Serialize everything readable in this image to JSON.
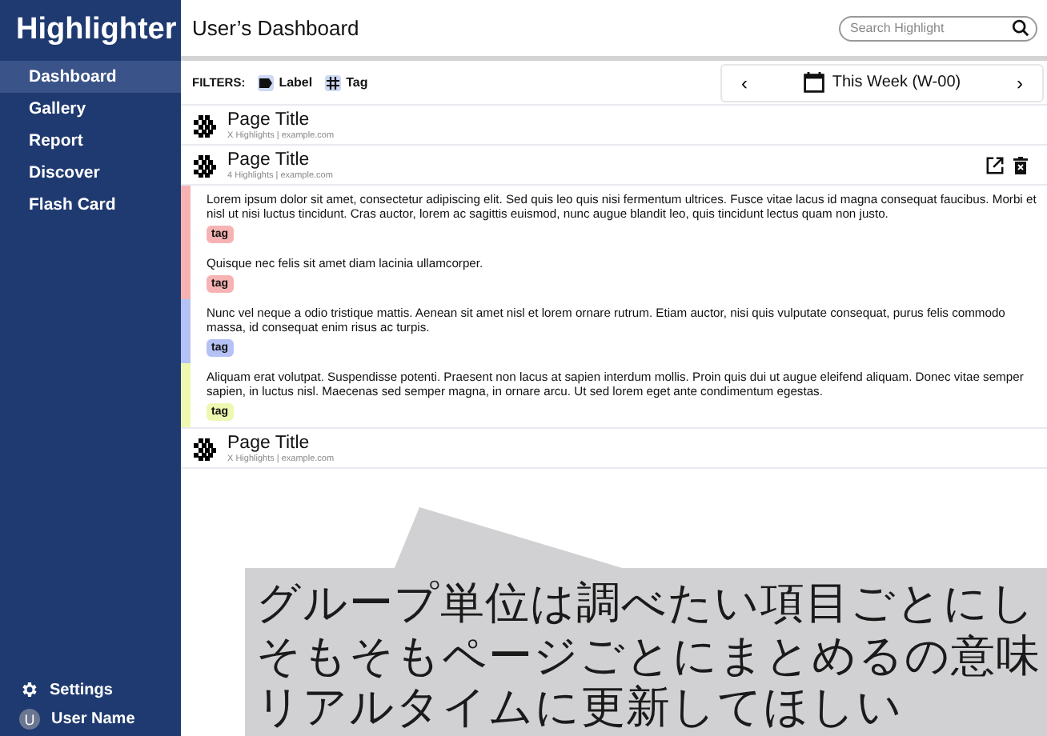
{
  "sidebar": {
    "logo": "Highlighter",
    "items": [
      {
        "label": "Dashboard",
        "selected": true
      },
      {
        "label": "Gallery",
        "selected": false
      },
      {
        "label": "Report",
        "selected": false
      },
      {
        "label": "Discover",
        "selected": false
      },
      {
        "label": "Flash Card",
        "selected": false
      }
    ],
    "settings": "Settings",
    "user": {
      "initial": "U",
      "name": "User Name"
    }
  },
  "header": {
    "title": "User’s Dashboard",
    "search": {
      "placeholder": "Search Highlight"
    }
  },
  "filters": {
    "label": "FILTERS:",
    "chips": [
      {
        "kind": "label",
        "label": "Label"
      },
      {
        "kind": "tag",
        "label": "Tag"
      }
    ]
  },
  "week": {
    "prev": "‹",
    "label": "This Week (W-00)",
    "next": "›"
  },
  "pages": [
    {
      "title": "Page Title",
      "meta": "X Highlights | example.com",
      "expanded": false
    },
    {
      "title": "Page Title",
      "meta": "4 Highlights | example.com",
      "expanded": true,
      "highlights": [
        {
          "text": "Lorem ipsum dolor sit amet, consectetur adipiscing elit. Sed quis leo quis nisi fermentum ultrices. Fusce vitae lacus id magna consequat faucibus. Morbi et nisl ut nisi luctus tincidunt. Cras auctor, lorem ac sagittis euismod, nunc augue blandit leo, quis tincidunt lectus quam non justo.",
          "tag": "tag",
          "color": "#f7b3b3"
        },
        {
          "text": "Quisque nec felis sit amet diam lacinia ullamcorper.",
          "tag": "tag",
          "color": "#f7b3b3"
        },
        {
          "text": "Nunc vel neque a odio tristique mattis. Aenean sit amet nisl et lorem ornare rutrum. Etiam auctor, nisi quis vulputate consequat, purus felis commodo massa, id consequat enim risus ac turpis.",
          "tag": "tag",
          "color": "#b5c2f5"
        },
        {
          "text": "Aliquam erat volutpat. Suspendisse potenti. Praesent non lacus at sapien interdum mollis. Proin quis dui ut augue eleifend aliquam. Donec vitae semper sapien, in luctus nisl. Maecenas sed semper magna, in ornare arcu. Ut sed lorem eget ante condimentum egestas.",
          "tag": "tag",
          "color": "#eef8b0"
        }
      ]
    },
    {
      "title": "Page Title",
      "meta": "X Highlights | example.com",
      "expanded": false
    }
  ],
  "comment": {
    "lines": [
      "グループ単位は調べたい項目ごとにし",
      "そもそもページごとにまとめるの意味",
      "リアルタイムに更新してほしい"
    ]
  }
}
